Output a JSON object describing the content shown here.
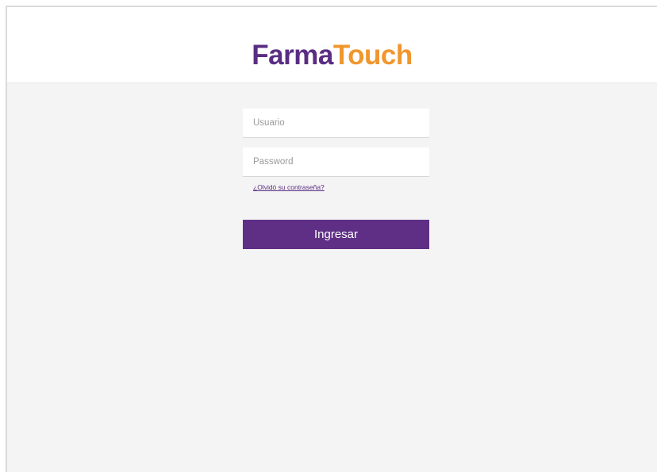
{
  "brand": {
    "part1": "Farma",
    "part2": "Touch",
    "color_primary": "#5a2d82",
    "color_accent": "#f0962d"
  },
  "login": {
    "username_placeholder": "Usuario",
    "password_placeholder": "Password",
    "forgot_link": "¿Olvidó su contraseña?",
    "submit_label": "Ingresar"
  }
}
